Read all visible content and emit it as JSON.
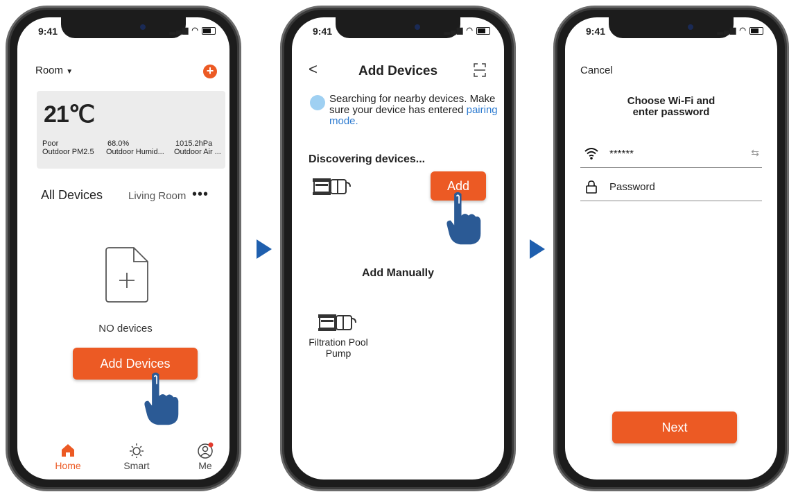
{
  "screen1": {
    "time": "9:41",
    "room_label": "Room",
    "add_symbol": "+",
    "temperature": "21℃",
    "metrics": [
      {
        "value": "Poor",
        "label": "Outdoor PM2.5"
      },
      {
        "value": "68.0%",
        "label": "Outdoor Humid..."
      },
      {
        "value": "1015.2hPa",
        "label": "Outdoor Air ..."
      }
    ],
    "tab_all": "All Devices",
    "tab_living": "Living Room",
    "more": "•••",
    "empty_text": "NO devices",
    "add_devices": "Add Devices",
    "nav": [
      {
        "label": "Home",
        "icon": "home-icon"
      },
      {
        "label": "Smart",
        "icon": "sun-icon"
      },
      {
        "label": "Me",
        "icon": "profile-icon"
      }
    ]
  },
  "screen2": {
    "time": "9:41",
    "back": "<",
    "title": "Add Devices",
    "search_text": "Searching for nearby devices. Make sure your device has entered",
    "search_link": "pairing mode.",
    "discovering": "Discovering devices...",
    "add_button": "Add",
    "add_manually": "Add Manually",
    "manual_device": "Filtration Pool Pump"
  },
  "screen3": {
    "time": "9:41",
    "cancel": "Cancel",
    "title_line1": "Choose Wi-Fi and",
    "title_line2": "enter password",
    "wifi_value": "******",
    "password_placeholder": "Password",
    "next": "Next"
  },
  "colors": {
    "accent": "#ec5a24",
    "arrow": "#1f5fae",
    "hand": "#2b5a95",
    "link": "#2d7bd0"
  }
}
